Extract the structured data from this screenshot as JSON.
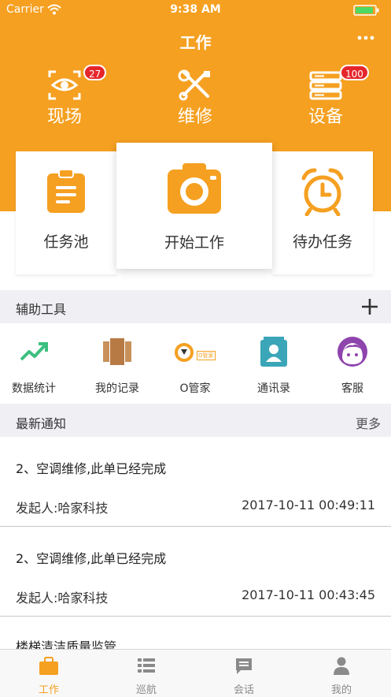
{
  "status_bar": {
    "carrier": "Carrier",
    "time": "9:38 AM"
  },
  "header": {
    "title": "工作",
    "more_icon": "more-dots-icon"
  },
  "top_actions": [
    {
      "label": "现场",
      "icon": "eye-scan-icon",
      "badge": "27"
    },
    {
      "label": "维修",
      "icon": "tools-icon"
    },
    {
      "label": "设备",
      "icon": "server-icon",
      "badge": "100"
    }
  ],
  "cards": [
    {
      "label": "任务池",
      "icon": "clipboard-icon"
    },
    {
      "label": "开始工作",
      "icon": "camera-icon"
    },
    {
      "label": "待办任务",
      "icon": "alarm-clock-icon"
    }
  ],
  "tools_section": {
    "title": "辅助工具",
    "add_icon": "plus-icon"
  },
  "tools": [
    {
      "label": "数据统计",
      "icon": "trend-up-icon"
    },
    {
      "label": "我的记录",
      "icon": "book-icon"
    },
    {
      "label": "O管家",
      "icon": "o-butler-logo-icon",
      "logo_text": "O管家"
    },
    {
      "label": "通讯录",
      "icon": "contacts-icon"
    },
    {
      "label": "客服",
      "icon": "service-face-icon"
    }
  ],
  "notice_section": {
    "title": "最新通知",
    "more": "更多"
  },
  "notices": [
    {
      "title": "2、空调维修,此单已经完成",
      "sender": "发起人:哈家科技",
      "time": "2017-10-11 00:49:11"
    },
    {
      "title": "2、空调维修,此单已经完成",
      "sender": "发起人:哈家科技",
      "time": "2017-10-11 00:43:45"
    },
    {
      "title": "楼梯清洁质量监管"
    }
  ],
  "tabbar": [
    {
      "label": "工作",
      "icon": "briefcase-icon",
      "active": true
    },
    {
      "label": "巡航",
      "icon": "list-icon"
    },
    {
      "label": "会话",
      "icon": "chat-icon"
    },
    {
      "label": "我的",
      "icon": "person-icon"
    }
  ],
  "colors": {
    "accent": "#f5a021",
    "badge": "#e5262b",
    "section_bg": "#efeff4"
  }
}
